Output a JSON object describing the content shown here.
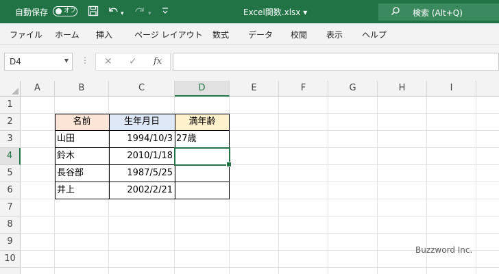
{
  "titlebar": {
    "autosave_label": "自動保存",
    "autosave_state": "オフ",
    "filename": "Excel関数.xlsx",
    "filename_caret": "▾",
    "search_placeholder": "検索 (Alt+Q)",
    "bg_color": "#217346"
  },
  "ribbon": {
    "tabs": [
      "ファイル",
      "ホーム",
      "挿入",
      "ページ レイアウト",
      "数式",
      "データ",
      "校閲",
      "表示",
      "ヘルプ"
    ]
  },
  "formula_bar": {
    "name_box": "D4",
    "fx_label": "fx",
    "cancel_glyph": "✕",
    "enter_glyph": "✓",
    "formula": ""
  },
  "sheet": {
    "columns": [
      "A",
      "B",
      "C",
      "D",
      "E",
      "F",
      "G",
      "H",
      "I"
    ],
    "rows": [
      "1",
      "2",
      "3",
      "4",
      "5",
      "6",
      "7",
      "8",
      "9",
      "10"
    ],
    "active_cell": "D4",
    "accent_color": "#217346",
    "table": {
      "headers": [
        "名前",
        "生年月日",
        "満年齢"
      ],
      "header_colors": [
        "#fce4d6",
        "#dde7f5",
        "#fff1cc"
      ],
      "rows": [
        [
          "山田",
          "1994/10/3",
          "27歳"
        ],
        [
          "鈴木",
          "2010/1/18",
          ""
        ],
        [
          "長谷部",
          "1987/5/25",
          ""
        ],
        [
          "井上",
          "2002/2/21",
          ""
        ]
      ]
    }
  },
  "watermark": "Buzzword Inc."
}
